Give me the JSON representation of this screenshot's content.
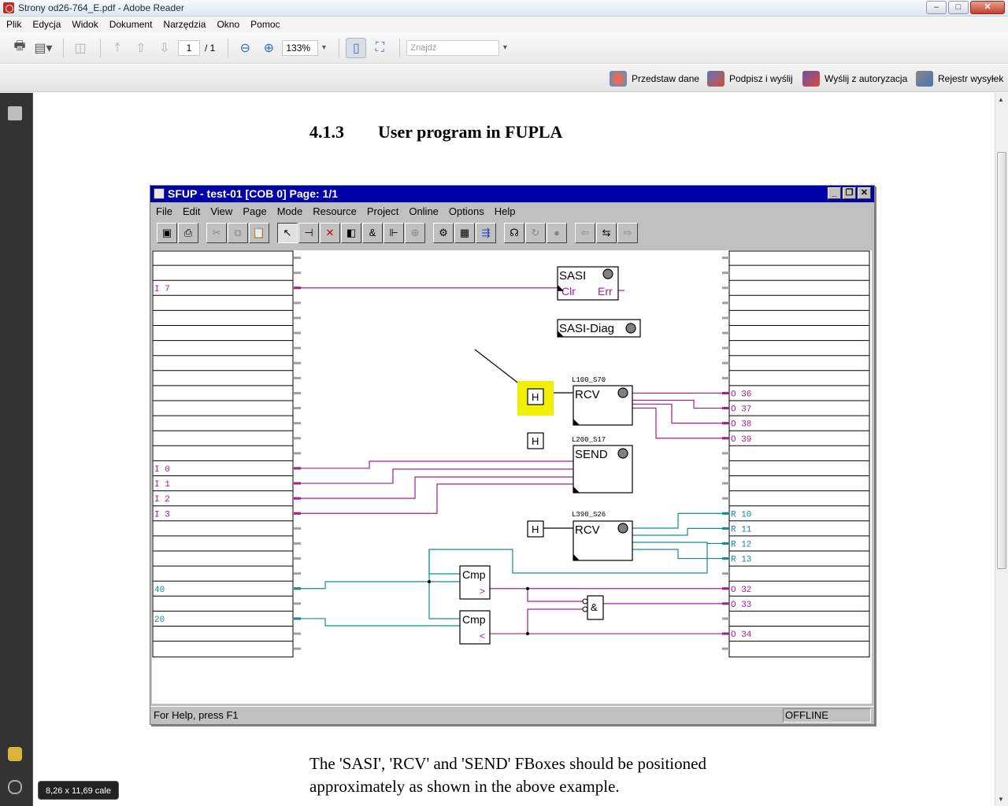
{
  "window": {
    "title": "Strony od26-764_E.pdf - Adobe Reader",
    "controls": [
      "–",
      "□",
      "✕"
    ]
  },
  "menu": [
    "Plik",
    "Edycja",
    "Widok",
    "Dokument",
    "Narzędzia",
    "Okno",
    "Pomoc"
  ],
  "toolbar": {
    "page_current": "1",
    "page_total": "/ 1",
    "zoom": "133%",
    "find_placeholder": "Znajdź"
  },
  "toolbar2": {
    "present": "Przedstaw dane",
    "sign": "Podpisz i wyślij",
    "send_auth": "Wyślij z autoryzacja",
    "registry": "Rejestr wysyłek"
  },
  "document": {
    "section_number": "4.1.3",
    "section_title": "User program in FUPLA",
    "caption": "The 'SASI', 'RCV' and 'SEND' FBoxes should be positioned approximately as shown in the above example."
  },
  "sfup": {
    "title": "SFUP - test-01 [COB 0] Page: 1/1",
    "menu": [
      "File",
      "Edit",
      "View",
      "Page",
      "Mode",
      "Resource",
      "Project",
      "Online",
      "Options",
      "Help"
    ],
    "status_left": "For Help, press F1",
    "status_right": "OFFLINE",
    "left_labels": [
      {
        "row": 2,
        "text": "I 7"
      },
      {
        "row": 14,
        "text": "I 0"
      },
      {
        "row": 15,
        "text": "I 1"
      },
      {
        "row": 16,
        "text": "I 2"
      },
      {
        "row": 17,
        "text": "I 3"
      },
      {
        "row": 22,
        "text": "40"
      },
      {
        "row": 24,
        "text": "20"
      }
    ],
    "right_labels": [
      {
        "row": 9,
        "text": "O 36"
      },
      {
        "row": 10,
        "text": "O 37"
      },
      {
        "row": 11,
        "text": "O 38"
      },
      {
        "row": 12,
        "text": "O 39"
      },
      {
        "row": 17,
        "text": "R 10"
      },
      {
        "row": 18,
        "text": "R 11"
      },
      {
        "row": 19,
        "text": "R 12"
      },
      {
        "row": 20,
        "text": "R 13"
      },
      {
        "row": 22,
        "text": "O 32"
      },
      {
        "row": 23,
        "text": "O 33"
      },
      {
        "row": 25,
        "text": "O 34"
      }
    ],
    "fboxes": {
      "sasi": {
        "name": "SASI",
        "in": "Clr",
        "out": "Err"
      },
      "sasi_diag": {
        "name": "SASI-Diag"
      },
      "rcv1": {
        "name": "RCV",
        "label": "L100_S70"
      },
      "send": {
        "name": "SEND",
        "label": "L200_S17"
      },
      "rcv2": {
        "name": "RCV",
        "label": "L390_S26"
      },
      "cmp1": {
        "name": "Cmp",
        "out": ">"
      },
      "cmp2": {
        "name": "Cmp",
        "out": "<"
      },
      "and": {
        "name": "&"
      },
      "h": "H"
    },
    "colors": {
      "wire_bool": "#a0208f",
      "wire_int": "#148c8c",
      "highlight": "#f0f000"
    }
  },
  "tooltip": "8,26 x 11,69 cale"
}
